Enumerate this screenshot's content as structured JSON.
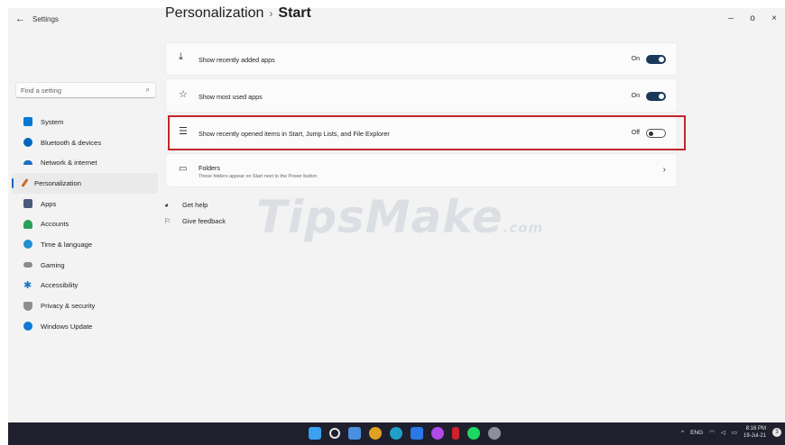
{
  "window": {
    "app_title": "Settings",
    "controls": {
      "minimize": "–",
      "maximize": "o",
      "close": "×"
    }
  },
  "sidebar": {
    "search_placeholder": "Find a setting",
    "items": [
      {
        "label": "System",
        "icon": "monitor-icon",
        "color": "#0078d4"
      },
      {
        "label": "Bluetooth & devices",
        "icon": "bluetooth-icon",
        "color": "#0067c0"
      },
      {
        "label": "Network & internet",
        "icon": "wifi-icon",
        "color": "#1e6fbf"
      },
      {
        "label": "Personalization",
        "icon": "brush-icon",
        "color": "#d16a28",
        "active": true
      },
      {
        "label": "Apps",
        "icon": "apps-icon",
        "color": "#4a5a7a"
      },
      {
        "label": "Accounts",
        "icon": "person-icon",
        "color": "#2ca05a"
      },
      {
        "label": "Time & language",
        "icon": "globe-clock-icon",
        "color": "#1f8fd0"
      },
      {
        "label": "Gaming",
        "icon": "gamepad-icon",
        "color": "#8a8a8a"
      },
      {
        "label": "Accessibility",
        "icon": "accessibility-icon",
        "color": "#1a73c8"
      },
      {
        "label": "Privacy & security",
        "icon": "shield-icon",
        "color": "#8d8d8d"
      },
      {
        "label": "Windows Update",
        "icon": "update-icon",
        "color": "#0f78d4"
      }
    ]
  },
  "header": {
    "parent": "Personalization",
    "separator": "›",
    "current": "Start"
  },
  "settings": [
    {
      "label": "Show recently added apps",
      "state": "On",
      "on": true
    },
    {
      "label": "Show most used apps",
      "state": "On",
      "on": true
    },
    {
      "label": "Show recently opened items in Start, Jump Lists, and File Explorer",
      "state": "Off",
      "on": false
    },
    {
      "label": "Folders",
      "description": "These folders appear on Start next to the Power button"
    }
  ],
  "links": {
    "help": "Get help",
    "feedback": "Give feedback"
  },
  "watermark": {
    "main": "TipsMake",
    "suffix": ".com"
  },
  "taskbar": {
    "tray": {
      "lang": "ENG",
      "time": "8:16 PM",
      "date": "19-Jul-21",
      "notifications": "3"
    }
  }
}
